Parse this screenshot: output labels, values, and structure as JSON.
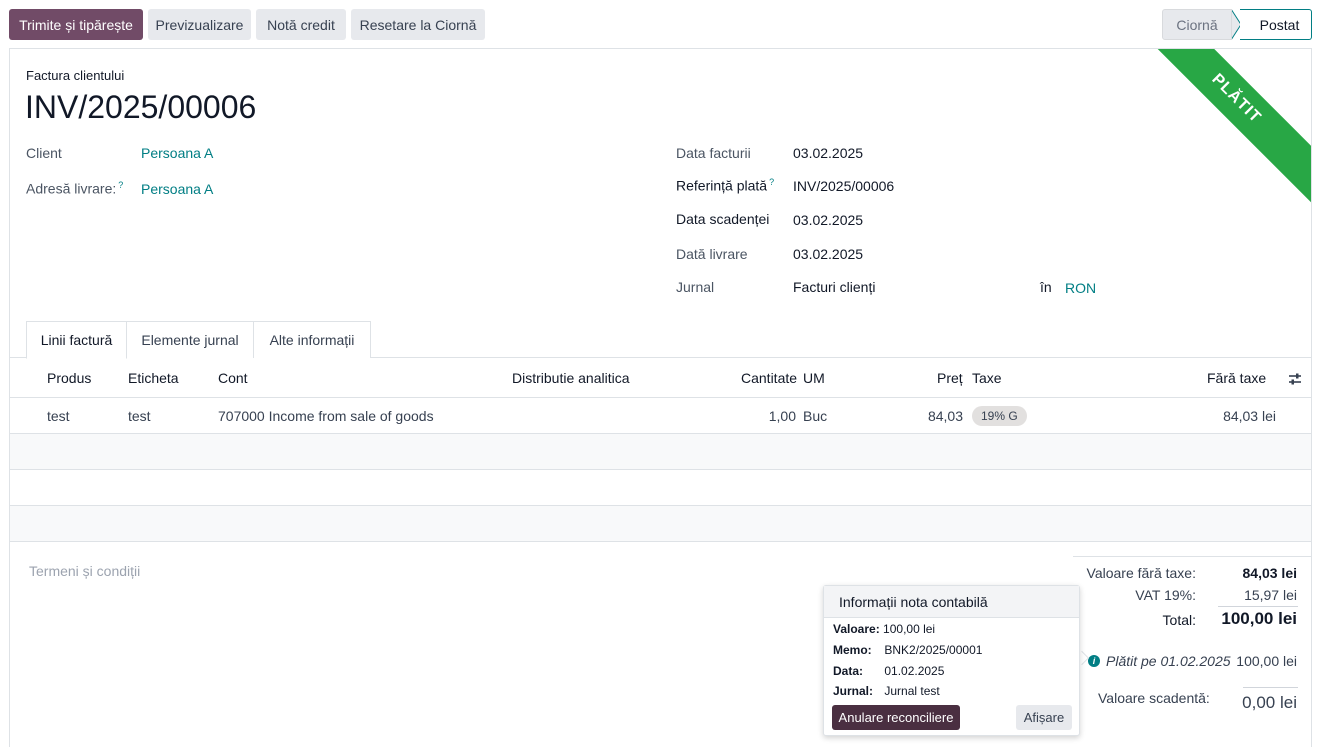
{
  "toolbar": {
    "send_print": "Trimite și tipărește",
    "preview": "Previzualizare",
    "credit_note": "Notă credit",
    "reset_draft": "Resetare la Ciornă"
  },
  "statusbar": {
    "draft": "Ciornă",
    "posted": "Postat"
  },
  "ribbon": "PLĂTIT",
  "document": {
    "type": "Factura clientului",
    "name": "INV/2025/00006"
  },
  "fields": {
    "client_label": "Client",
    "client_value": "Persoana A",
    "delivery_label": "Adresă livrare:",
    "delivery_value": "Persoana A",
    "invoice_date_label": "Data facturii",
    "invoice_date_value": "03.02.2025",
    "payment_ref_label": "Referință plată",
    "payment_ref_value": "INV/2025/00006",
    "due_date_label": "Data scadenței",
    "due_date_value": "03.02.2025",
    "delivery_date_label": "Dată livrare",
    "delivery_date_value": "03.02.2025",
    "journal_label": "Jurnal",
    "journal_value": "Facturi clienți",
    "currency_in": "în",
    "currency_value": "RON",
    "help_mark": "?"
  },
  "tabs": [
    {
      "label": "Linii factură"
    },
    {
      "label": "Elemente jurnal"
    },
    {
      "label": "Alte informații"
    }
  ],
  "table": {
    "headers": {
      "product": "Produs",
      "label": "Eticheta",
      "account": "Cont",
      "analytic": "Distributie analitica",
      "quantity": "Cantitate",
      "uom": "UM",
      "price": "Preț",
      "taxes": "Taxe",
      "subtotal": "Fără taxe"
    },
    "rows": [
      {
        "product": "test",
        "label": "test",
        "account": "707000 Income from sale of goods",
        "quantity": "1,00",
        "uom": "Buc",
        "price": "84,03",
        "tax": "19% G",
        "subtotal": "84,03 lei"
      }
    ]
  },
  "terms_placeholder": "Termeni și condiții",
  "totals": {
    "untaxed_label": "Valoare fără taxe:",
    "untaxed_value": "84,03 lei",
    "vat_label": "VAT 19%:",
    "vat_value": "15,97 lei",
    "total_label": "Total:",
    "total_value": "100,00 lei",
    "paid_label": "Plătit pe 01.02.2025",
    "paid_value": "100,00 lei",
    "due_label": "Valoare scadentă:",
    "due_value": "0,00 lei"
  },
  "popover": {
    "title": "Informații nota contabilă",
    "amount_label": "Valoare:",
    "amount_value": "100,00 lei",
    "memo_label": "Memo:",
    "memo_value": "BNK2/2025/00001",
    "date_label": "Data:",
    "date_value": "01.02.2025",
    "journal_label": "Jurnal:",
    "journal_value": "Jurnal test",
    "unreconcile": "Anulare reconciliere",
    "view": "Afișare"
  },
  "colors": {
    "primary": "#714b67",
    "link": "#017e84",
    "ribbon": "#28a745",
    "unreconcile_btn": "#4a2f41"
  }
}
